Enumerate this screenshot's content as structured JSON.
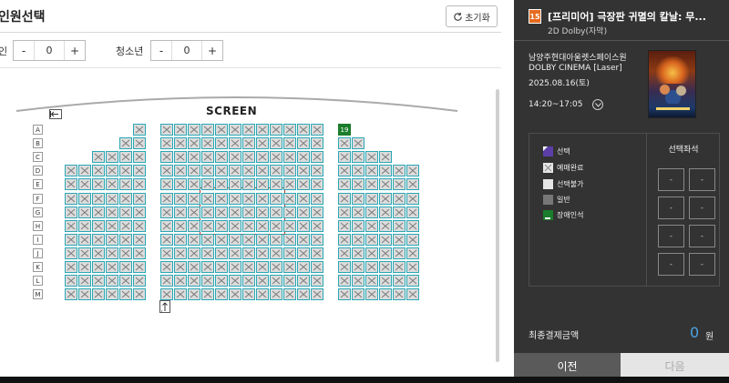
{
  "header": {
    "title": "인원선택",
    "reset_label": "초기화"
  },
  "counters": {
    "adult_label": "인",
    "adult_value": "0",
    "youth_label": "청소년",
    "youth_value": "0",
    "minus": "-",
    "plus": "+"
  },
  "seatmap": {
    "screen_label": "SCREEN",
    "rows": [
      "A",
      "B",
      "C",
      "D",
      "E",
      "F",
      "G",
      "H",
      "I",
      "J",
      "K",
      "L",
      "M"
    ],
    "wheelchair_seat_label": "19"
  },
  "movie": {
    "age_rating": "15",
    "title": "[프리미어] 극장판 귀멸의 칼날: 무...",
    "format": "2D Dolby(자막)",
    "theater": "남양주현대아울렛스페이스원",
    "hall": "DOLBY CINEMA [Laser]",
    "date": "2025.08.16(토)",
    "time": "14:20~17:05"
  },
  "legend": {
    "selected": "선택",
    "sold": "예매완료",
    "unavailable": "선택불가",
    "general": "일반",
    "disabled": "장애인석",
    "selected_seats_title": "선택좌석",
    "empty_slot": "-"
  },
  "payment": {
    "total_label": "최종결제금액",
    "total_value": "0",
    "unit": "원"
  },
  "buttons": {
    "prev": "이전",
    "next": "다음"
  },
  "colors": {
    "selected": "#5b3ea8",
    "disabled_seat": "#1a7d2b",
    "seat_border": "#2aa7b4",
    "total": "#4aa3e6",
    "age_badge": "#e66a1d"
  }
}
